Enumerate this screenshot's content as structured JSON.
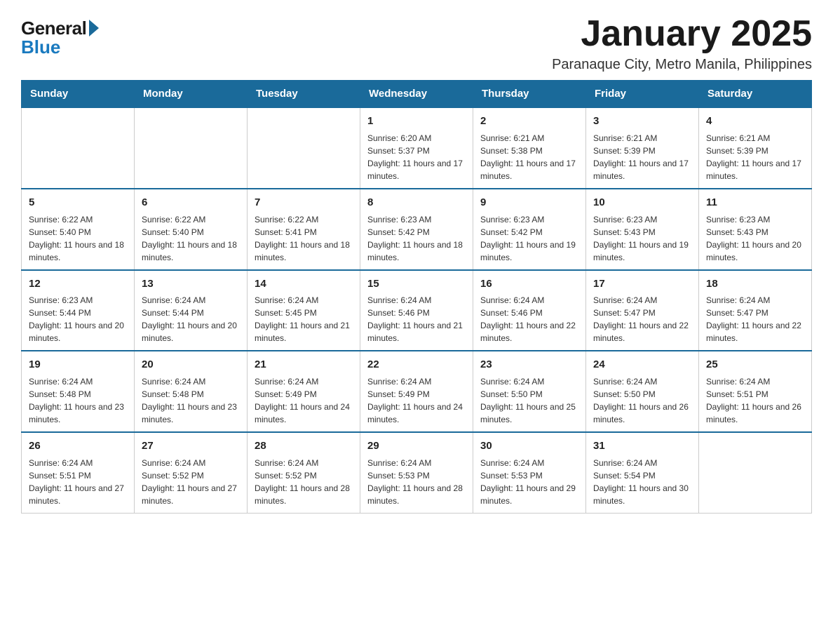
{
  "logo": {
    "general": "General",
    "blue": "Blue"
  },
  "title": "January 2025",
  "location": "Paranaque City, Metro Manila, Philippines",
  "days_of_week": [
    "Sunday",
    "Monday",
    "Tuesday",
    "Wednesday",
    "Thursday",
    "Friday",
    "Saturday"
  ],
  "weeks": [
    [
      {
        "day": "",
        "sunrise": "",
        "sunset": "",
        "daylight": ""
      },
      {
        "day": "",
        "sunrise": "",
        "sunset": "",
        "daylight": ""
      },
      {
        "day": "",
        "sunrise": "",
        "sunset": "",
        "daylight": ""
      },
      {
        "day": "1",
        "sunrise": "Sunrise: 6:20 AM",
        "sunset": "Sunset: 5:37 PM",
        "daylight": "Daylight: 11 hours and 17 minutes."
      },
      {
        "day": "2",
        "sunrise": "Sunrise: 6:21 AM",
        "sunset": "Sunset: 5:38 PM",
        "daylight": "Daylight: 11 hours and 17 minutes."
      },
      {
        "day": "3",
        "sunrise": "Sunrise: 6:21 AM",
        "sunset": "Sunset: 5:39 PM",
        "daylight": "Daylight: 11 hours and 17 minutes."
      },
      {
        "day": "4",
        "sunrise": "Sunrise: 6:21 AM",
        "sunset": "Sunset: 5:39 PM",
        "daylight": "Daylight: 11 hours and 17 minutes."
      }
    ],
    [
      {
        "day": "5",
        "sunrise": "Sunrise: 6:22 AM",
        "sunset": "Sunset: 5:40 PM",
        "daylight": "Daylight: 11 hours and 18 minutes."
      },
      {
        "day": "6",
        "sunrise": "Sunrise: 6:22 AM",
        "sunset": "Sunset: 5:40 PM",
        "daylight": "Daylight: 11 hours and 18 minutes."
      },
      {
        "day": "7",
        "sunrise": "Sunrise: 6:22 AM",
        "sunset": "Sunset: 5:41 PM",
        "daylight": "Daylight: 11 hours and 18 minutes."
      },
      {
        "day": "8",
        "sunrise": "Sunrise: 6:23 AM",
        "sunset": "Sunset: 5:42 PM",
        "daylight": "Daylight: 11 hours and 18 minutes."
      },
      {
        "day": "9",
        "sunrise": "Sunrise: 6:23 AM",
        "sunset": "Sunset: 5:42 PM",
        "daylight": "Daylight: 11 hours and 19 minutes."
      },
      {
        "day": "10",
        "sunrise": "Sunrise: 6:23 AM",
        "sunset": "Sunset: 5:43 PM",
        "daylight": "Daylight: 11 hours and 19 minutes."
      },
      {
        "day": "11",
        "sunrise": "Sunrise: 6:23 AM",
        "sunset": "Sunset: 5:43 PM",
        "daylight": "Daylight: 11 hours and 20 minutes."
      }
    ],
    [
      {
        "day": "12",
        "sunrise": "Sunrise: 6:23 AM",
        "sunset": "Sunset: 5:44 PM",
        "daylight": "Daylight: 11 hours and 20 minutes."
      },
      {
        "day": "13",
        "sunrise": "Sunrise: 6:24 AM",
        "sunset": "Sunset: 5:44 PM",
        "daylight": "Daylight: 11 hours and 20 minutes."
      },
      {
        "day": "14",
        "sunrise": "Sunrise: 6:24 AM",
        "sunset": "Sunset: 5:45 PM",
        "daylight": "Daylight: 11 hours and 21 minutes."
      },
      {
        "day": "15",
        "sunrise": "Sunrise: 6:24 AM",
        "sunset": "Sunset: 5:46 PM",
        "daylight": "Daylight: 11 hours and 21 minutes."
      },
      {
        "day": "16",
        "sunrise": "Sunrise: 6:24 AM",
        "sunset": "Sunset: 5:46 PM",
        "daylight": "Daylight: 11 hours and 22 minutes."
      },
      {
        "day": "17",
        "sunrise": "Sunrise: 6:24 AM",
        "sunset": "Sunset: 5:47 PM",
        "daylight": "Daylight: 11 hours and 22 minutes."
      },
      {
        "day": "18",
        "sunrise": "Sunrise: 6:24 AM",
        "sunset": "Sunset: 5:47 PM",
        "daylight": "Daylight: 11 hours and 22 minutes."
      }
    ],
    [
      {
        "day": "19",
        "sunrise": "Sunrise: 6:24 AM",
        "sunset": "Sunset: 5:48 PM",
        "daylight": "Daylight: 11 hours and 23 minutes."
      },
      {
        "day": "20",
        "sunrise": "Sunrise: 6:24 AM",
        "sunset": "Sunset: 5:48 PM",
        "daylight": "Daylight: 11 hours and 23 minutes."
      },
      {
        "day": "21",
        "sunrise": "Sunrise: 6:24 AM",
        "sunset": "Sunset: 5:49 PM",
        "daylight": "Daylight: 11 hours and 24 minutes."
      },
      {
        "day": "22",
        "sunrise": "Sunrise: 6:24 AM",
        "sunset": "Sunset: 5:49 PM",
        "daylight": "Daylight: 11 hours and 24 minutes."
      },
      {
        "day": "23",
        "sunrise": "Sunrise: 6:24 AM",
        "sunset": "Sunset: 5:50 PM",
        "daylight": "Daylight: 11 hours and 25 minutes."
      },
      {
        "day": "24",
        "sunrise": "Sunrise: 6:24 AM",
        "sunset": "Sunset: 5:50 PM",
        "daylight": "Daylight: 11 hours and 26 minutes."
      },
      {
        "day": "25",
        "sunrise": "Sunrise: 6:24 AM",
        "sunset": "Sunset: 5:51 PM",
        "daylight": "Daylight: 11 hours and 26 minutes."
      }
    ],
    [
      {
        "day": "26",
        "sunrise": "Sunrise: 6:24 AM",
        "sunset": "Sunset: 5:51 PM",
        "daylight": "Daylight: 11 hours and 27 minutes."
      },
      {
        "day": "27",
        "sunrise": "Sunrise: 6:24 AM",
        "sunset": "Sunset: 5:52 PM",
        "daylight": "Daylight: 11 hours and 27 minutes."
      },
      {
        "day": "28",
        "sunrise": "Sunrise: 6:24 AM",
        "sunset": "Sunset: 5:52 PM",
        "daylight": "Daylight: 11 hours and 28 minutes."
      },
      {
        "day": "29",
        "sunrise": "Sunrise: 6:24 AM",
        "sunset": "Sunset: 5:53 PM",
        "daylight": "Daylight: 11 hours and 28 minutes."
      },
      {
        "day": "30",
        "sunrise": "Sunrise: 6:24 AM",
        "sunset": "Sunset: 5:53 PM",
        "daylight": "Daylight: 11 hours and 29 minutes."
      },
      {
        "day": "31",
        "sunrise": "Sunrise: 6:24 AM",
        "sunset": "Sunset: 5:54 PM",
        "daylight": "Daylight: 11 hours and 30 minutes."
      },
      {
        "day": "",
        "sunrise": "",
        "sunset": "",
        "daylight": ""
      }
    ]
  ]
}
